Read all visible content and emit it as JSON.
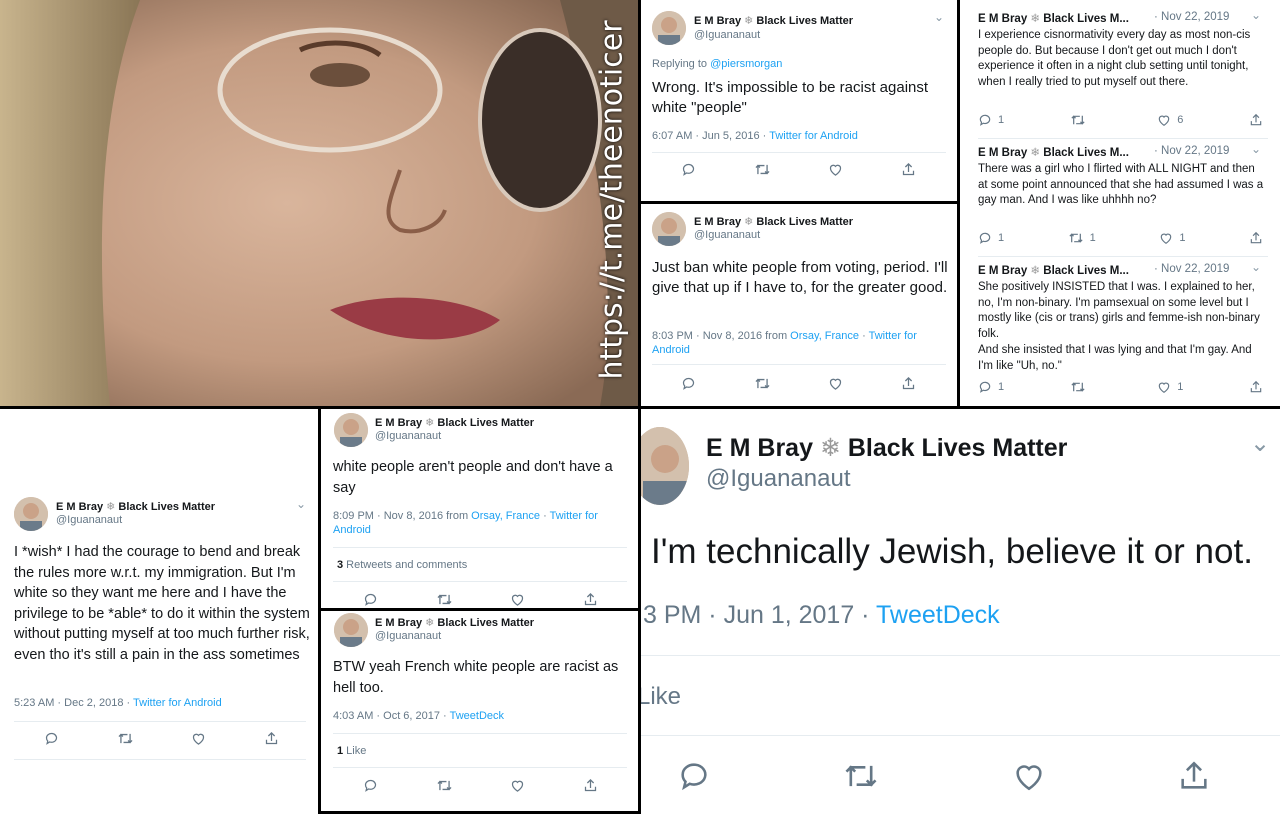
{
  "colors": {
    "link": "#1da1f2",
    "muted": "#657786",
    "text": "#14171a",
    "divider": "#e6ecf0"
  },
  "icons": [
    "reply-icon",
    "retweet-icon",
    "like-icon",
    "share-icon",
    "chevron-down-icon",
    "snowflake-icon"
  ],
  "watermark": "https://t.me/theenoticer",
  "author": {
    "name": "E M Bray",
    "tag": "Black Lives Matter",
    "tag_short": "Black Lives M...",
    "handle": "@Iguananaut",
    "snowflake": "❄"
  },
  "tweets": {
    "t1": {
      "reply_prefix": "Replying to ",
      "reply_user": "@piersmorgan",
      "text": "Wrong. It's impossible to be racist against white \"people\"",
      "time": "6:07 AM · Jun 5, 2016 · ",
      "source": "Twitter for Android"
    },
    "t2": {
      "text": "Just ban white people from voting, period. I'll give that up if I have to, for the greater good.",
      "time": "8:03 PM · Nov 8, 2016 from ",
      "location": "Orsay, France",
      "sep": " · ",
      "source": "Twitter for Android"
    },
    "t3": {
      "date": "· Nov 22, 2019",
      "text": "I experience cisnormativity every day as most non-cis people do. But because I don't get out much I don't experience it often in a night club setting until tonight, when I really tried to put myself out there.",
      "replies": "1",
      "retweets": "",
      "likes": "6"
    },
    "t4": {
      "date": "· Nov 22, 2019",
      "text": "There was a girl who I flirted with ALL NIGHT and then at some point announced that she had assumed I was a gay man. And I was like uhhhh no?",
      "replies": "1",
      "retweets": "1",
      "likes": "1"
    },
    "t5": {
      "date": "· Nov 22, 2019",
      "text": "She positively INSISTED that I was. I explained to her, no, I'm non-binary. I'm pamsexual on some level but I mostly like (cis or trans) girls and femme-ish non-binary folk.",
      "text2": "And she insisted that I was lying and that I'm gay. And I'm like \"Uh, no.\"",
      "replies": "1",
      "retweets": "",
      "likes": "1"
    },
    "t6": {
      "text": "I *wish* I had the courage to bend and break the rules more w.r.t. my immigration. But I'm white so they want me here and I have the privilege to be *able* to do it within the system without putting myself at too much further risk, even tho it's still a pain in the ass sometimes",
      "time": "5:23 AM · Dec 2, 2018 · ",
      "source": "Twitter for Android"
    },
    "t7": {
      "text": "white people aren't people and don't have a say",
      "time": "8:09 PM · Nov 8, 2016 from ",
      "location": "Orsay, France",
      "sep": " · ",
      "source": "Twitter for Android",
      "rt_count": "3",
      "rt_label": " Retweets and comments"
    },
    "t8": {
      "text": "BTW yeah French white people are racist as hell too.",
      "time": "4:03 AM · Oct 6, 2017 · ",
      "source": "TweetDeck",
      "like_count": "1",
      "like_label": " Like"
    },
    "t9": {
      "text": "I'm technically Jewish, believe it or not.",
      "time": "3 PM · Jun 1, 2017 · ",
      "source": "TweetDeck",
      "like_label": "Like"
    }
  }
}
